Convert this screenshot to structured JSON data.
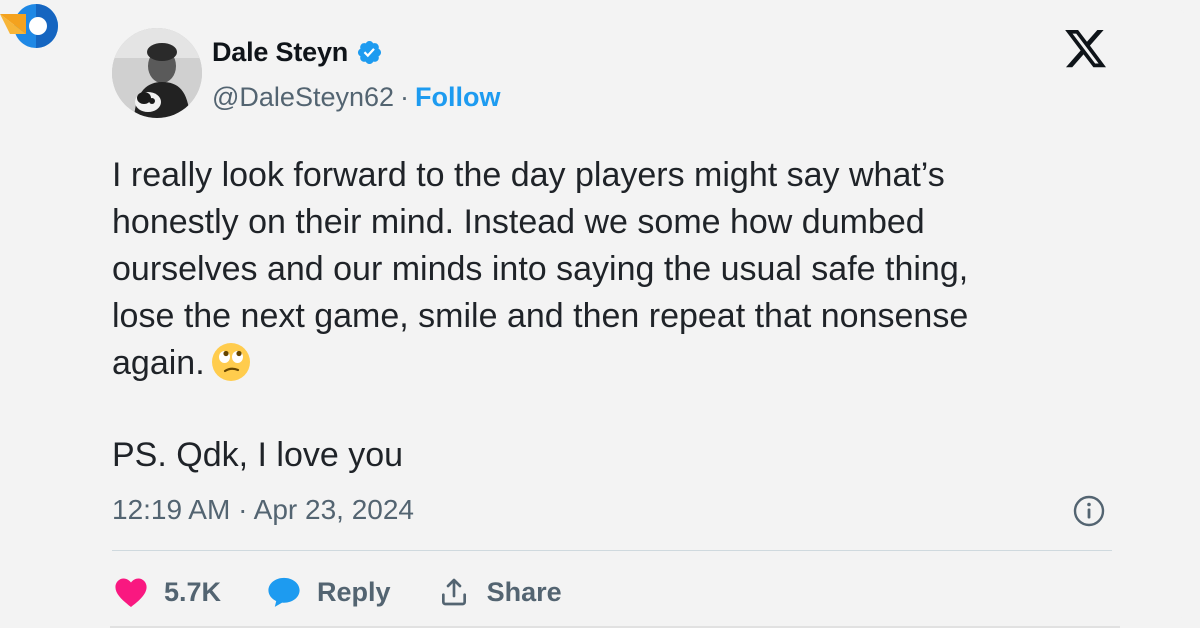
{
  "tweet": {
    "display_name": "Dale Steyn",
    "handle": "@DaleSteyn62",
    "separator": "·",
    "follow_label": "Follow",
    "text": "I really look forward to the day players might say what’s\nhonestly on their mind. Instead we some how dumbed\nourselves and our minds into saying the usual safe thing,\nlose the next game, smile and then repeat that nonsense\nagain.",
    "emoji": "face-with-rolling-eyes",
    "ps": "PS. Qdk, I love you",
    "timestamp": "12:19 AM · Apr 23, 2024"
  },
  "actions": {
    "like_count": "5.7K",
    "reply_label": "Reply",
    "share_label": "Share"
  },
  "icons": {
    "like": "heart-icon",
    "reply": "speech-bubble-icon",
    "share": "share-icon",
    "info": "info-icon",
    "brand": "x-logo-icon",
    "verified": "verified-badge-icon",
    "site": "site-logo-icon"
  },
  "colors": {
    "accent": "#1d9bf0",
    "like": "#f91880",
    "muted": "#536471",
    "background": "#f3f3f3",
    "text": "#0f1419"
  }
}
